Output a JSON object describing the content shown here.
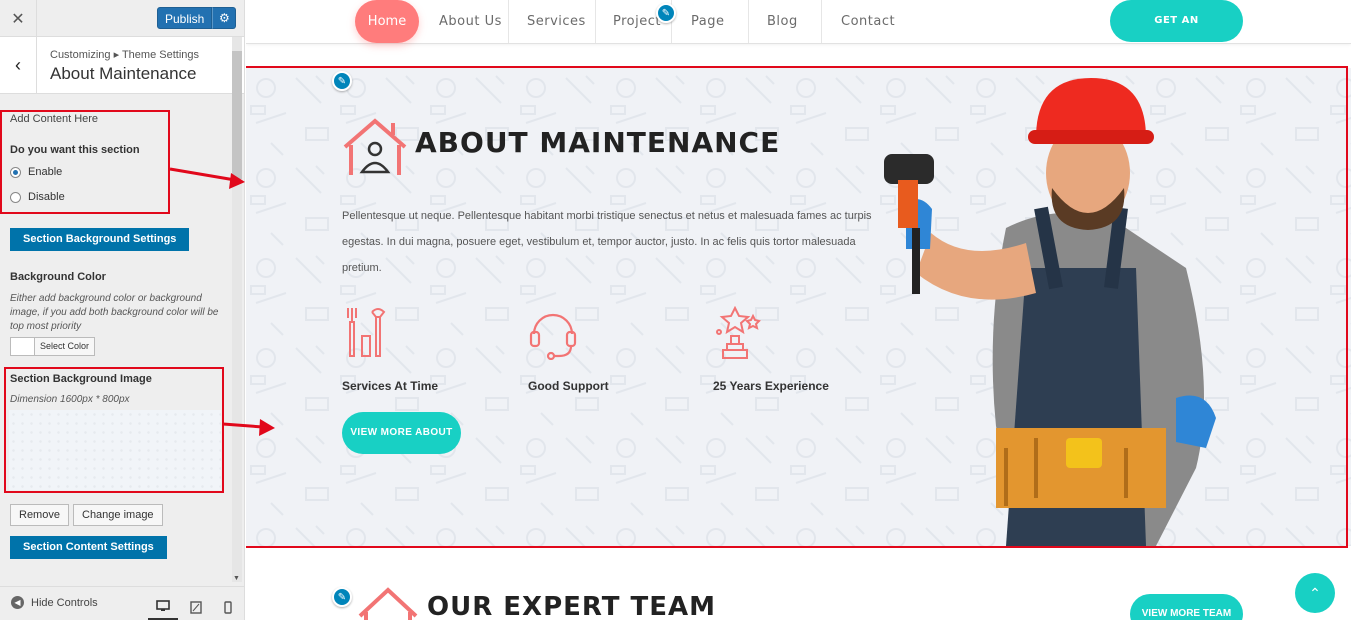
{
  "sidebar": {
    "publish_label": "Publish",
    "breadcrumb": "Customizing ▸ Theme Settings",
    "panel_title": "About Maintenance",
    "add_content": "Add Content Here",
    "section_toggle_label": "Do you want this section",
    "options": [
      {
        "label": "Enable",
        "checked": true
      },
      {
        "label": "Disable",
        "checked": false
      }
    ],
    "bg_settings_button": "Section Background Settings",
    "bg_color_label": "Background Color",
    "bg_color_help": "Either add background color or background image, if you add both background color will be top most priority",
    "select_color": "Select Color",
    "bg_image_label": "Section Background Image",
    "bg_image_dimension": "Dimension 1600px * 800px",
    "remove_button": "Remove",
    "change_image_button": "Change image",
    "content_settings_button": "Section Content Settings",
    "hide_controls": "Hide Controls",
    "annotation_color": "#e1081b"
  },
  "nav": {
    "items": [
      "Home",
      "About Us",
      "Services",
      "Project",
      "Page",
      "Blog",
      "Contact"
    ],
    "appointment_button": "GET AN APPOINTMENT"
  },
  "about": {
    "heading": "ABOUT MAINTENANCE",
    "paragraph": "Pellentesque ut neque. Pellentesque habitant morbi tristique senectus et netus et malesuada fames ac turpis egestas. In dui magna, posuere eget, vestibulum et, tempor auctor, justo. In ac felis quis tortor malesuada pretium.",
    "features": [
      {
        "label": "Services At Time",
        "icon": "tools-icon"
      },
      {
        "label": "Good Support",
        "icon": "headset-icon"
      },
      {
        "label": "25 Years Experience",
        "icon": "trophy-icon"
      }
    ],
    "button": "VIEW MORE ABOUT"
  },
  "team": {
    "heading": "OUR EXPERT TEAM",
    "button": "VIEW MORE TEAM"
  },
  "colors": {
    "accent": "#18d0c4",
    "home_pill": "#ff7c7c",
    "wp_blue": "#0073aa",
    "icon_red": "#f27474"
  }
}
